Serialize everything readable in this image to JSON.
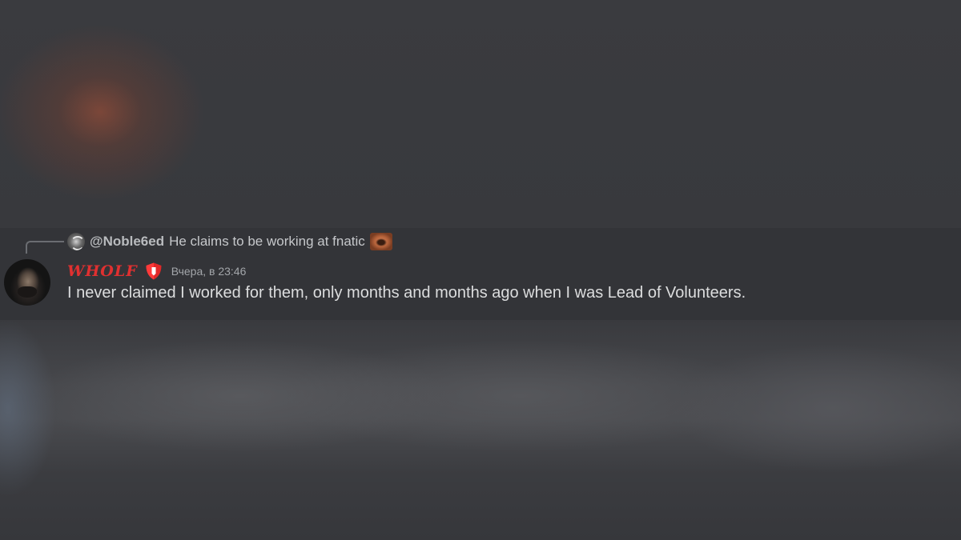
{
  "reply": {
    "username": "@Noble6ed",
    "text": "He claims to be working at fnatic",
    "avatar_icon": "user-avatar-icon",
    "emoji": "face-emoji"
  },
  "message": {
    "username": "WHOLF",
    "username_color": "#e03030",
    "badge_icon": "red-shield-icon",
    "timestamp": "Вчера, в 23:46",
    "content": "I never claimed I worked for them, only months and months ago when I was Lead of Volunteers."
  },
  "colors": {
    "background": "#36373b",
    "message_background": "#333438",
    "text": "#dcddde",
    "muted_text": "#a3a6aa",
    "accent_glow": "#914b37"
  }
}
